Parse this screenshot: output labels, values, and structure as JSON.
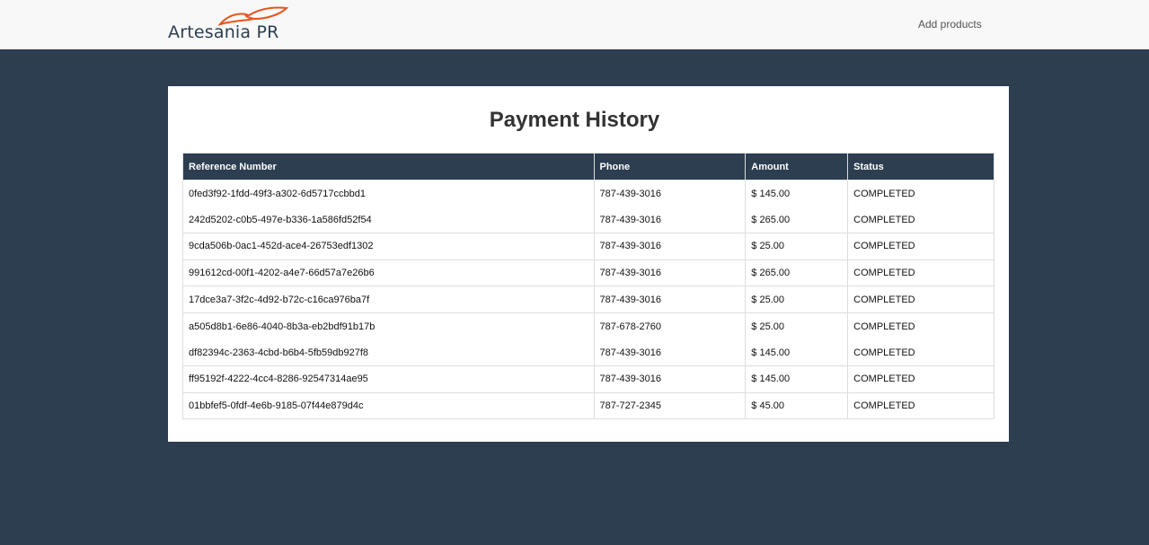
{
  "navbar": {
    "brand": "Artesania PR",
    "links": [
      {
        "label": "Add products"
      }
    ]
  },
  "colors": {
    "background": "#2c3e50",
    "header": "#2c3e50",
    "brand_accent": "#e8541e"
  },
  "page": {
    "title": "Payment History"
  },
  "table": {
    "columns": [
      "Reference Number",
      "Phone",
      "Amount",
      "Status"
    ],
    "rows": [
      {
        "ref": "0fed3f92-1fdd-49f3-a302-6d5717ccbbd1",
        "phone": "787-439-3016",
        "amount": "$ 145.00",
        "status": "COMPLETED"
      },
      {
        "ref": "242d5202-c0b5-497e-b336-1a586fd52f54",
        "phone": "787-439-3016",
        "amount": "$ 265.00",
        "status": "COMPLETED"
      },
      {
        "ref": "9cda506b-0ac1-452d-ace4-26753edf1302",
        "phone": "787-439-3016",
        "amount": "$ 25.00",
        "status": "COMPLETED"
      },
      {
        "ref": "991612cd-00f1-4202-a4e7-66d57a7e26b6",
        "phone": "787-439-3016",
        "amount": "$ 265.00",
        "status": "COMPLETED"
      },
      {
        "ref": "17dce3a7-3f2c-4d92-b72c-c16ca976ba7f",
        "phone": "787-439-3016",
        "amount": "$ 25.00",
        "status": "COMPLETED"
      },
      {
        "ref": "a505d8b1-6e86-4040-8b3a-eb2bdf91b17b",
        "phone": "787-678-2760",
        "amount": "$ 25.00",
        "status": "COMPLETED"
      },
      {
        "ref": "df82394c-2363-4cbd-b6b4-5fb59db927f8",
        "phone": "787-439-3016",
        "amount": "$ 145.00",
        "status": "COMPLETED"
      },
      {
        "ref": "ff95192f-4222-4cc4-8286-92547314ae95",
        "phone": "787-439-3016",
        "amount": "$ 145.00",
        "status": "COMPLETED"
      },
      {
        "ref": "01bbfef5-0fdf-4e6b-9185-07f44e879d4c",
        "phone": "787-727-2345",
        "amount": "$ 45.00",
        "status": "COMPLETED"
      }
    ]
  }
}
